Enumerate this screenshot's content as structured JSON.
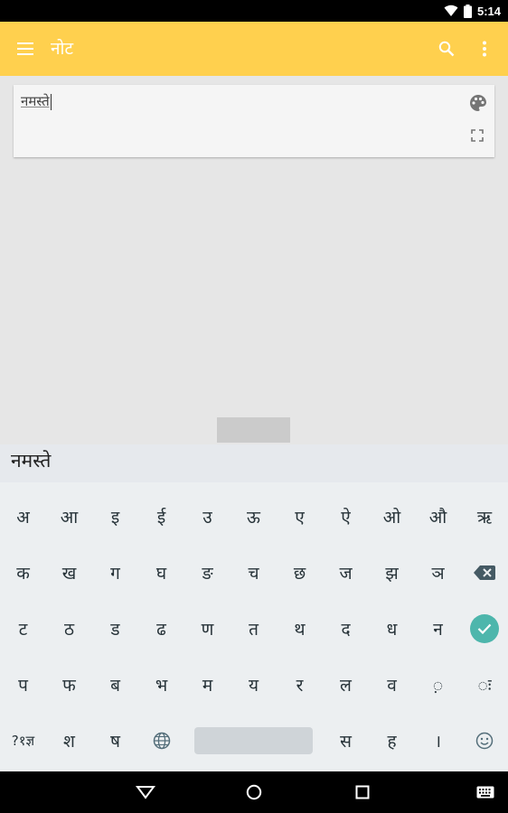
{
  "status": {
    "time": "5:14"
  },
  "appbar": {
    "title": "नोट"
  },
  "note": {
    "text": "नमस्ते"
  },
  "suggestion": {
    "word": "नमस्ते"
  },
  "keyboard": {
    "row1": [
      "अ",
      "आ",
      "इ",
      "ई",
      "उ",
      "ऊ",
      "ए",
      "ऐ",
      "ओ",
      "औ",
      "ऋ"
    ],
    "row2": [
      "क",
      "ख",
      "ग",
      "घ",
      "ङ",
      "च",
      "छ",
      "ज",
      "झ",
      "ञ"
    ],
    "row3": [
      "ट",
      "ठ",
      "ड",
      "ढ",
      "ण",
      "त",
      "थ",
      "द",
      "ध",
      "न"
    ],
    "row4": [
      "प",
      "फ",
      "ब",
      "भ",
      "म",
      "य",
      "र",
      "ल",
      "व",
      "़",
      "ः"
    ],
    "row5": {
      "symbols": "?१ज्ञ",
      "left": [
        "श",
        "ष"
      ],
      "right": [
        "स",
        "ह",
        "।"
      ]
    }
  },
  "colors": {
    "appbar": "#ffd04e",
    "accent": "#4db6ac",
    "keyboard": "#eceff1"
  },
  "icons": {
    "menu": "menu-icon",
    "search": "search-icon",
    "overflow": "more-vert-icon",
    "palette": "palette-icon",
    "fullscreen": "fullscreen-icon",
    "backspace": "backspace-icon",
    "enter": "check-icon",
    "globe": "globe-icon",
    "emoji": "emoji-icon",
    "back": "back-triangle-icon",
    "home": "home-circle-icon",
    "recents": "recents-square-icon",
    "keyboard": "keyboard-icon"
  }
}
